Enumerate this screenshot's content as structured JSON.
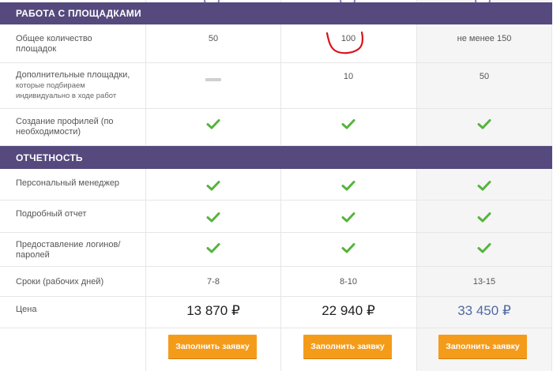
{
  "colors": {
    "band": "#56497e",
    "check": "#56b43c",
    "button": "#f59b1a",
    "accent_price": "#4f6aa5",
    "annotation": "#d9121b"
  },
  "sections": [
    {
      "title": "РАБОТА С ПЛОЩАДКАМИ"
    },
    {
      "title": "ОТЧЕТНОСТЬ"
    }
  ],
  "rows": {
    "sites_total": {
      "label": "Общее количество площадок",
      "values": [
        "50",
        "100",
        "не менее 150"
      ]
    },
    "extra_sites": {
      "label": "Дополнительные площадки,",
      "sublabel": "которые подбираем индивидуально в ходе работ",
      "values": [
        "dash",
        "10",
        "50"
      ]
    },
    "profiles": {
      "label": "Создание профилей (по необходимости)",
      "values": [
        "check",
        "check",
        "check"
      ]
    },
    "manager": {
      "label": "Персональный менеджер",
      "values": [
        "check",
        "check",
        "check"
      ]
    },
    "report": {
      "label": "Подробный отчет",
      "values": [
        "check",
        "check",
        "check"
      ]
    },
    "logins": {
      "label": "Предоставление логинов/ паролей",
      "values": [
        "check",
        "check",
        "check"
      ]
    },
    "terms": {
      "label": "Сроки (рабочих дней)",
      "values": [
        "7-8",
        "8-10",
        "13-15"
      ]
    },
    "price": {
      "label": "Цена",
      "values": [
        "13 870 ₽",
        "22 940 ₽",
        "33 450 ₽"
      ]
    }
  },
  "actions": {
    "apply_label": "Заполнить заявку"
  },
  "icons": {
    "check": "check-icon",
    "dash": "dash-icon"
  }
}
